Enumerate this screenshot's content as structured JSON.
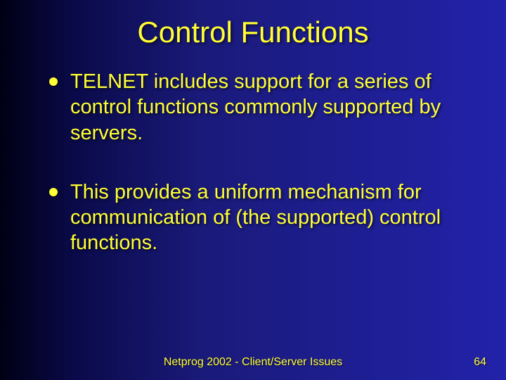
{
  "title": "Control Functions",
  "bullets": [
    "TELNET includes support for a series of control functions commonly supported by servers.",
    "This provides a uniform mechanism for communication of (the supported) control functions."
  ],
  "footer": {
    "center": "Netprog 2002 - Client/Server Issues",
    "page": "64"
  }
}
